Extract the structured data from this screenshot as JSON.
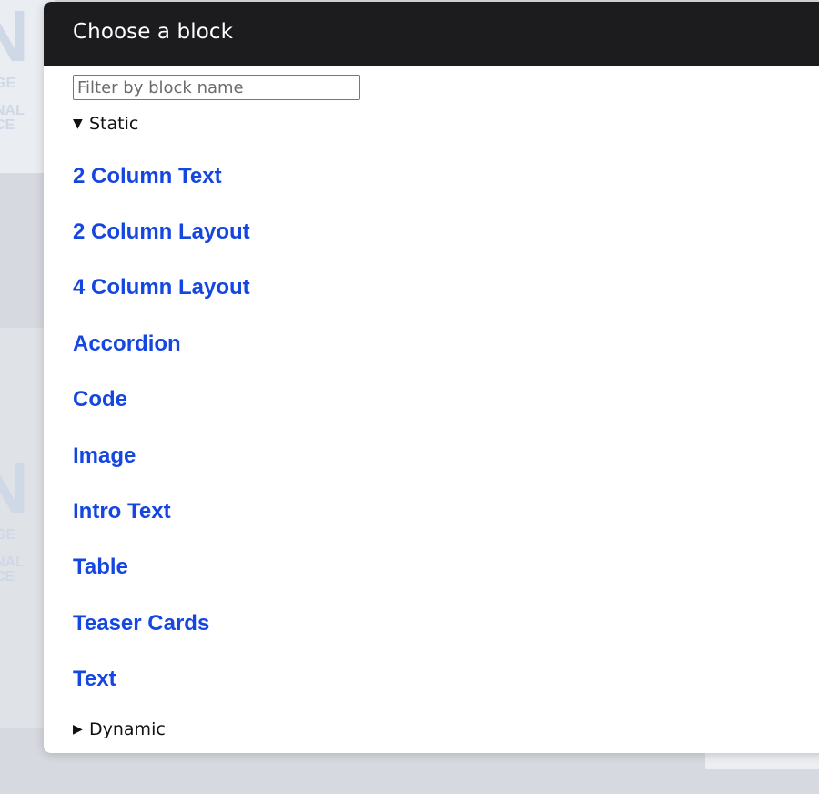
{
  "background": {
    "logo_big": "N",
    "logo_line1": "GE",
    "logo_line2": "NAL",
    "logo_line3": "CE"
  },
  "modal": {
    "title": "Choose a block",
    "filter": {
      "placeholder": "Filter by block name",
      "value": ""
    },
    "groups": {
      "static": {
        "label": "Static",
        "expanded": true,
        "toggle_icon": "▼",
        "items": [
          "2 Column Text",
          "2 Column Layout",
          "4 Column Layout",
          "Accordion",
          "Code",
          "Image",
          "Intro Text",
          "Table",
          "Teaser Cards",
          "Text"
        ]
      },
      "dynamic": {
        "label": "Dynamic",
        "expanded": false,
        "toggle_icon": "▶"
      }
    }
  },
  "colors": {
    "header_bg": "#1c1c1e",
    "link": "#1547e0",
    "backdrop": "#d6d9df"
  }
}
